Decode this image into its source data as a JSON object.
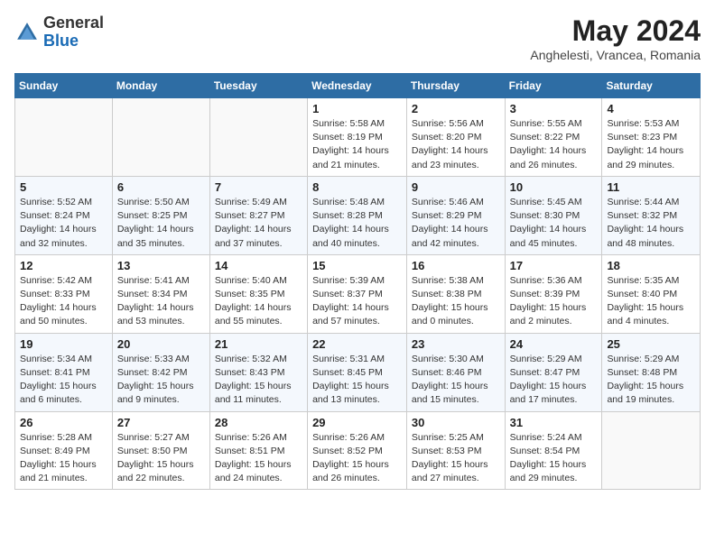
{
  "header": {
    "logo_general": "General",
    "logo_blue": "Blue",
    "month_title": "May 2024",
    "location": "Anghelesti, Vrancea, Romania"
  },
  "weekdays": [
    "Sunday",
    "Monday",
    "Tuesday",
    "Wednesday",
    "Thursday",
    "Friday",
    "Saturday"
  ],
  "weeks": [
    [
      {
        "day": "",
        "info": ""
      },
      {
        "day": "",
        "info": ""
      },
      {
        "day": "",
        "info": ""
      },
      {
        "day": "1",
        "info": "Sunrise: 5:58 AM\nSunset: 8:19 PM\nDaylight: 14 hours\nand 21 minutes."
      },
      {
        "day": "2",
        "info": "Sunrise: 5:56 AM\nSunset: 8:20 PM\nDaylight: 14 hours\nand 23 minutes."
      },
      {
        "day": "3",
        "info": "Sunrise: 5:55 AM\nSunset: 8:22 PM\nDaylight: 14 hours\nand 26 minutes."
      },
      {
        "day": "4",
        "info": "Sunrise: 5:53 AM\nSunset: 8:23 PM\nDaylight: 14 hours\nand 29 minutes."
      }
    ],
    [
      {
        "day": "5",
        "info": "Sunrise: 5:52 AM\nSunset: 8:24 PM\nDaylight: 14 hours\nand 32 minutes."
      },
      {
        "day": "6",
        "info": "Sunrise: 5:50 AM\nSunset: 8:25 PM\nDaylight: 14 hours\nand 35 minutes."
      },
      {
        "day": "7",
        "info": "Sunrise: 5:49 AM\nSunset: 8:27 PM\nDaylight: 14 hours\nand 37 minutes."
      },
      {
        "day": "8",
        "info": "Sunrise: 5:48 AM\nSunset: 8:28 PM\nDaylight: 14 hours\nand 40 minutes."
      },
      {
        "day": "9",
        "info": "Sunrise: 5:46 AM\nSunset: 8:29 PM\nDaylight: 14 hours\nand 42 minutes."
      },
      {
        "day": "10",
        "info": "Sunrise: 5:45 AM\nSunset: 8:30 PM\nDaylight: 14 hours\nand 45 minutes."
      },
      {
        "day": "11",
        "info": "Sunrise: 5:44 AM\nSunset: 8:32 PM\nDaylight: 14 hours\nand 48 minutes."
      }
    ],
    [
      {
        "day": "12",
        "info": "Sunrise: 5:42 AM\nSunset: 8:33 PM\nDaylight: 14 hours\nand 50 minutes."
      },
      {
        "day": "13",
        "info": "Sunrise: 5:41 AM\nSunset: 8:34 PM\nDaylight: 14 hours\nand 53 minutes."
      },
      {
        "day": "14",
        "info": "Sunrise: 5:40 AM\nSunset: 8:35 PM\nDaylight: 14 hours\nand 55 minutes."
      },
      {
        "day": "15",
        "info": "Sunrise: 5:39 AM\nSunset: 8:37 PM\nDaylight: 14 hours\nand 57 minutes."
      },
      {
        "day": "16",
        "info": "Sunrise: 5:38 AM\nSunset: 8:38 PM\nDaylight: 15 hours\nand 0 minutes."
      },
      {
        "day": "17",
        "info": "Sunrise: 5:36 AM\nSunset: 8:39 PM\nDaylight: 15 hours\nand 2 minutes."
      },
      {
        "day": "18",
        "info": "Sunrise: 5:35 AM\nSunset: 8:40 PM\nDaylight: 15 hours\nand 4 minutes."
      }
    ],
    [
      {
        "day": "19",
        "info": "Sunrise: 5:34 AM\nSunset: 8:41 PM\nDaylight: 15 hours\nand 6 minutes."
      },
      {
        "day": "20",
        "info": "Sunrise: 5:33 AM\nSunset: 8:42 PM\nDaylight: 15 hours\nand 9 minutes."
      },
      {
        "day": "21",
        "info": "Sunrise: 5:32 AM\nSunset: 8:43 PM\nDaylight: 15 hours\nand 11 minutes."
      },
      {
        "day": "22",
        "info": "Sunrise: 5:31 AM\nSunset: 8:45 PM\nDaylight: 15 hours\nand 13 minutes."
      },
      {
        "day": "23",
        "info": "Sunrise: 5:30 AM\nSunset: 8:46 PM\nDaylight: 15 hours\nand 15 minutes."
      },
      {
        "day": "24",
        "info": "Sunrise: 5:29 AM\nSunset: 8:47 PM\nDaylight: 15 hours\nand 17 minutes."
      },
      {
        "day": "25",
        "info": "Sunrise: 5:29 AM\nSunset: 8:48 PM\nDaylight: 15 hours\nand 19 minutes."
      }
    ],
    [
      {
        "day": "26",
        "info": "Sunrise: 5:28 AM\nSunset: 8:49 PM\nDaylight: 15 hours\nand 21 minutes."
      },
      {
        "day": "27",
        "info": "Sunrise: 5:27 AM\nSunset: 8:50 PM\nDaylight: 15 hours\nand 22 minutes."
      },
      {
        "day": "28",
        "info": "Sunrise: 5:26 AM\nSunset: 8:51 PM\nDaylight: 15 hours\nand 24 minutes."
      },
      {
        "day": "29",
        "info": "Sunrise: 5:26 AM\nSunset: 8:52 PM\nDaylight: 15 hours\nand 26 minutes."
      },
      {
        "day": "30",
        "info": "Sunrise: 5:25 AM\nSunset: 8:53 PM\nDaylight: 15 hours\nand 27 minutes."
      },
      {
        "day": "31",
        "info": "Sunrise: 5:24 AM\nSunset: 8:54 PM\nDaylight: 15 hours\nand 29 minutes."
      },
      {
        "day": "",
        "info": ""
      }
    ]
  ]
}
